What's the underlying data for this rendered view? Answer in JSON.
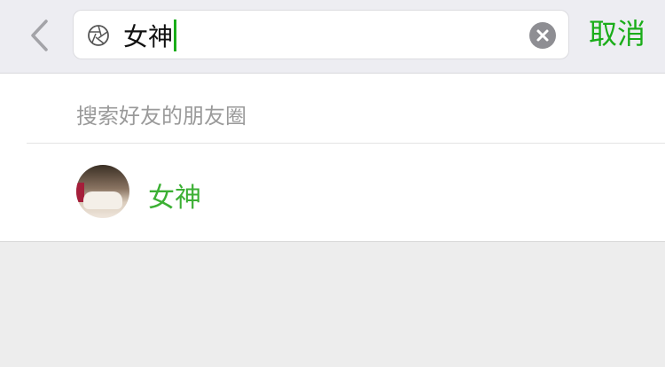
{
  "header": {
    "back_icon": "chevron-left-icon",
    "search_icon": "moments-shutter-icon",
    "search_value": "女神",
    "clear_icon": "clear-circle-icon",
    "cancel_label": "取消",
    "accent_color": "#1aad19"
  },
  "results": {
    "section_title": "搜索好友的朋友圈",
    "items": [
      {
        "name": "女神",
        "avatar": "cat-photo"
      }
    ]
  }
}
